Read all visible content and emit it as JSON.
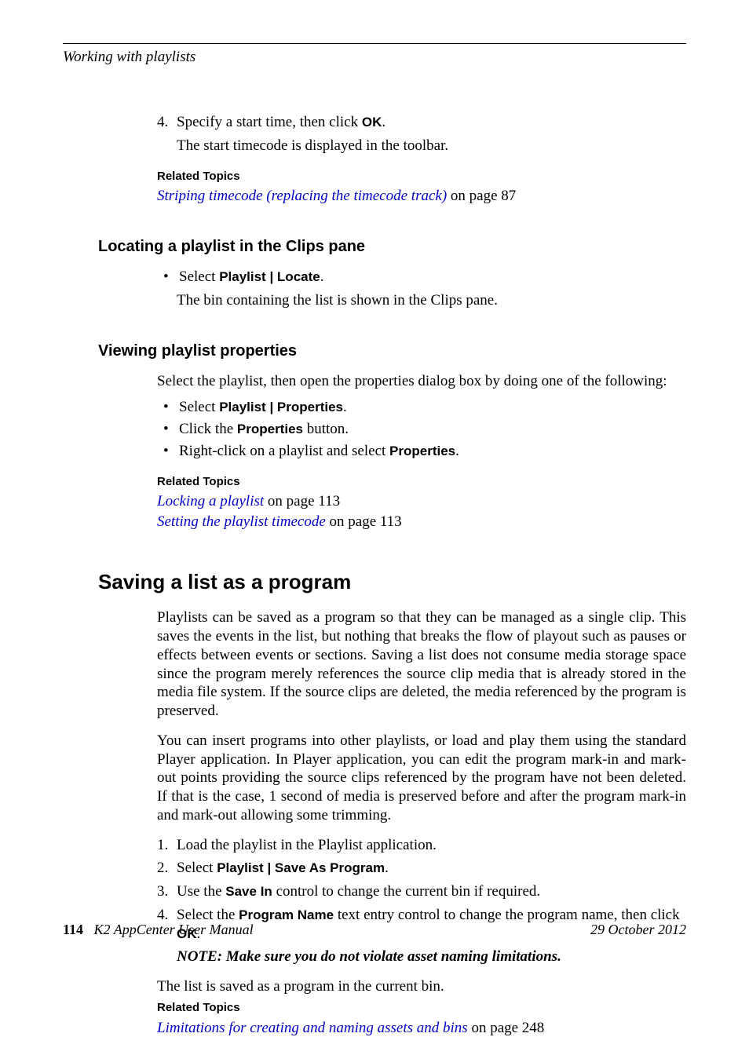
{
  "running_head": "Working with playlists",
  "step4": {
    "num": "4.",
    "text_a": "Specify a start time, then click ",
    "ok": "OK",
    "text_b": "."
  },
  "step4_sub": "The start timecode is displayed in the toolbar.",
  "related1": {
    "heading": "Related Topics",
    "link": "Striping timecode (replacing the timecode track)",
    "suffix": " on page 87"
  },
  "locating": {
    "heading": "Locating a playlist in the Clips pane",
    "bullet_pre": "Select ",
    "bullet_bold": "Playlist | Locate",
    "bullet_post": ".",
    "sub": "The bin containing the list is shown in the Clips pane."
  },
  "viewing": {
    "heading": "Viewing playlist properties",
    "intro": "Select the playlist, then open the properties dialog box by doing one of the following:",
    "b1_pre": "Select ",
    "b1_bold": "Playlist | Properties",
    "b1_post": ".",
    "b2_pre": "Click the ",
    "b2_bold": "Properties",
    "b2_post": " button.",
    "b3_pre": "Right-click on a playlist and select ",
    "b3_bold": "Properties",
    "b3_post": "."
  },
  "related2": {
    "heading": "Related Topics",
    "l1": "Locking a playlist",
    "l1suf": " on page 113",
    "l2": "Setting the playlist timecode",
    "l2suf": " on page 113"
  },
  "saving": {
    "heading": "Saving a list as a program",
    "p1": "Playlists can be saved as a program so that they can be managed as a single clip. This saves the events in the list, but nothing that breaks the flow of playout such as pauses or effects between events or sections. Saving a list does not consume media storage space since the program merely references the source clip media that is already stored in the media file system. If the source clips are deleted, the media referenced by the program is preserved.",
    "p2": "You can insert programs into other playlists, or load and play them using the standard Player application. In Player application, you can edit the program mark-in and mark-out points providing the source clips referenced by the program have not been deleted. If that is the case, 1 second of media is preserved before and after the program mark-in and mark-out allowing some trimming.",
    "s1": {
      "num": "1.",
      "txt": "Load the playlist in the Playlist application."
    },
    "s2": {
      "num": "2.",
      "pre": "Select ",
      "bold": "Playlist | Save As Program",
      "post": "."
    },
    "s3": {
      "num": "3.",
      "pre": "Use the ",
      "bold": "Save In",
      "post": " control to change the current bin if required."
    },
    "s4": {
      "num": "4.",
      "pre": "Select the ",
      "bold1": "Program Name",
      "mid": " text entry control to change the program name, then click ",
      "bold2": "OK",
      "post": "."
    },
    "note": "NOTE:  Make sure you do not violate asset naming limitations.",
    "result": "The list is saved as a program in the current bin."
  },
  "related3": {
    "heading": "Related Topics",
    "link": "Limitations for creating and naming assets and bins",
    "suffix": " on page 248"
  },
  "footer": {
    "pagenum": "114",
    "manual": "K2 AppCenter User Manual",
    "date": "29 October 2012"
  }
}
